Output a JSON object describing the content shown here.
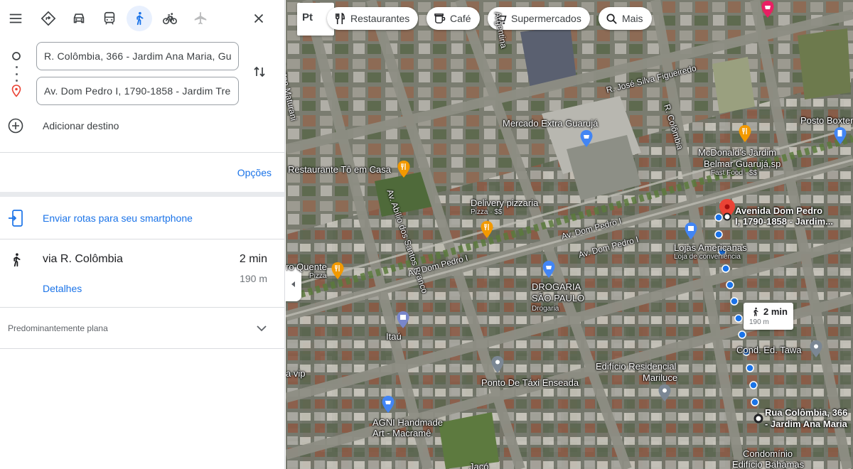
{
  "travel_modes": {
    "menu": "menu-icon",
    "modes": [
      "best-route-icon",
      "car-icon",
      "transit-icon",
      "walking-icon",
      "bicycle-icon",
      "flight-icon"
    ],
    "active": "walking-icon",
    "close": "close-icon"
  },
  "route": {
    "origin_value": "R. Colômbia, 366 - Jardim Ana Maria, Guarujá",
    "destination_value": "Av. Dom Pedro I, 1790-1858 - Jardim Tres Marias",
    "add_destination_label": "Adicionar destino"
  },
  "options_label": "Opções",
  "send_to_phone_label": "Enviar rotas para seu smartphone",
  "route_option": {
    "via": "via R. Colômbia",
    "time": "2 min",
    "distance": "190 m",
    "details_label": "Detalhes"
  },
  "terrain_label": "Predominantemente plana",
  "map": {
    "layers_label": "Pt",
    "chips": [
      {
        "label": "Restaurantes",
        "icon": "fork-knife-icon"
      },
      {
        "label": "Café",
        "icon": "coffee-icon"
      },
      {
        "label": "Supermercados",
        "icon": "cart-icon"
      },
      {
        "label": "Mais",
        "icon": "search-icon"
      }
    ],
    "places": {
      "mercado": "Mercado Extra Guarujá",
      "posto": "Posto Boxter",
      "mcd_1": "McDonald's Jardim",
      "mcd_2": "Belmar Guarujá,sp",
      "mcd_sub": "Fast Food · $$",
      "restaurante": "Restaurante Tô em Casa",
      "delivery": "Delivery pizzaria",
      "delivery_sub": "Pizza · $$",
      "quente": "ro Quente",
      "quente_sub": "Pizza",
      "drogaria_1": "DROGARIA",
      "drogaria_2": "SÃO PAULO",
      "drogaria_sub": "Drogaria",
      "lojas": "Lojas Americanas",
      "lojas_sub": "Loja de conveniência",
      "itau": "Itaú",
      "cond": "Cond. Ed. Tawa",
      "edificio_1": "Edifício Residencial",
      "edificio_2": "Mariluce",
      "ponto": "Ponto De Táxi Enseada",
      "agni_1": "AGNI Handmade",
      "agni_2": "Art - Macramê",
      "vip": "a vip",
      "dest_1": "Avenida Dom Pedro",
      "dest_2": "I, 1790-1858 - Jardim...",
      "origin_1": "Rua Colômbia, 366",
      "origin_2": "- Jardim Ana Maria",
      "condominio_1": "Condomínio",
      "condominio_2": "Edifício Bahamas",
      "bottom": "Jacó"
    },
    "streets": {
      "jose_silva": "R. José Silva Figueiredo",
      "colombia": "R. Colômbia",
      "abilio": "Av. Abílio dos Santos Branco",
      "dom_pedro_a": "Av. Dom Pedro I",
      "dom_pedro_b": "Av. Dom Pedro I",
      "dom_pedro_c": "Av. Dom Pedro I",
      "maturani": "Ayrton Maturani",
      "argentina": "Argentina"
    },
    "walk_bubble": {
      "time": "2 min",
      "distance": "190 m"
    },
    "colors": {
      "route_dot": "#1a73e8",
      "dest_pin": "#ea4335",
      "poi_orange": "#f29900",
      "poi_blue": "#4285f4"
    }
  }
}
